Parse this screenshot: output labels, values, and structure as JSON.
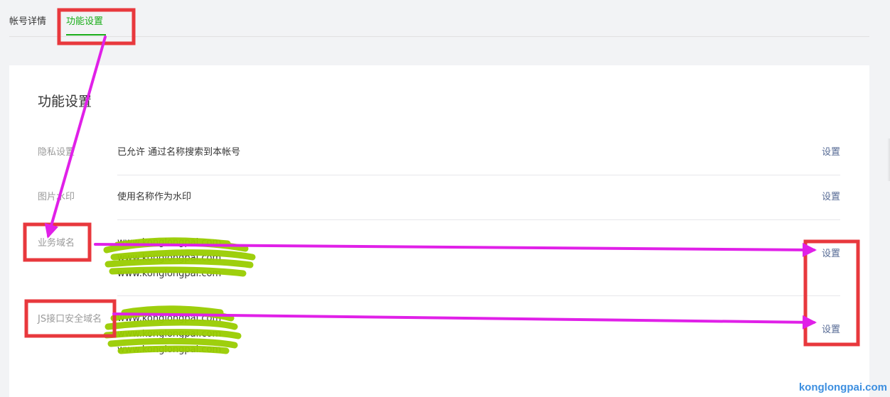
{
  "tabs": [
    {
      "label": "帐号详情",
      "active": false
    },
    {
      "label": "功能设置",
      "active": true
    }
  ],
  "section": {
    "title": "功能设置",
    "rows": [
      {
        "label": "隐私设置",
        "value": "已允许 通过名称搜索到本帐号",
        "action": "设置"
      },
      {
        "label": "图片水印",
        "value": "使用名称作为水印",
        "action": "设置"
      },
      {
        "label": "业务域名",
        "values": [
          "www.konglongpai.com",
          "www.konglongpai.com",
          "www.konglongpai.com"
        ],
        "action": "设置"
      },
      {
        "label": "JS接口安全域名",
        "values": [
          "www.konglongpai.com",
          "www.konglongpai.com",
          "www.konglongpai.com"
        ],
        "action": "设置"
      }
    ]
  },
  "watermark": "konglongpai.com",
  "colors": {
    "accent": "#1aad19",
    "link": "#576b95",
    "annotation_red": "#e8383d",
    "annotation_magenta": "#e020e8",
    "redaction_green": "#99cc00"
  }
}
